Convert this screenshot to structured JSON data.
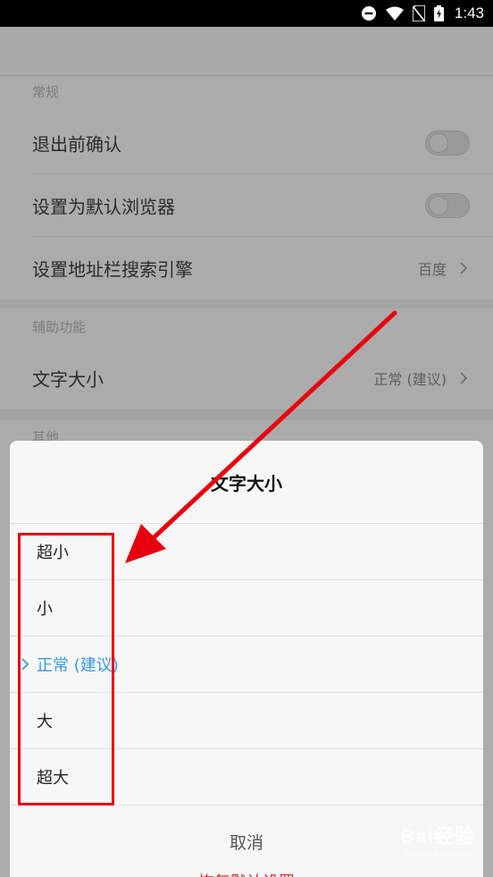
{
  "status": {
    "time": "1:43"
  },
  "sections": {
    "general": "常规",
    "accessibility": "辅助功能",
    "other": "其他"
  },
  "settings": {
    "confirm_exit": "退出前确认",
    "default_browser": "设置为默认浏览器",
    "search_engine": {
      "label": "设置地址栏搜索引擎",
      "value": "百度"
    },
    "text_size": {
      "label": "文字大小",
      "value": "正常 (建议)"
    }
  },
  "dialog": {
    "title": "文字大小",
    "options": [
      "超小",
      "小",
      "正常 (建议)",
      "大",
      "超大"
    ],
    "selected_index": 2,
    "cancel_label": "取消"
  },
  "bottom_text": "恢复默认设置",
  "watermark": {
    "main": "Bai经验",
    "sub": "jingyan.baidu.com"
  },
  "colors": {
    "selected": "#3b98e0",
    "annotation": "#e8000f"
  }
}
